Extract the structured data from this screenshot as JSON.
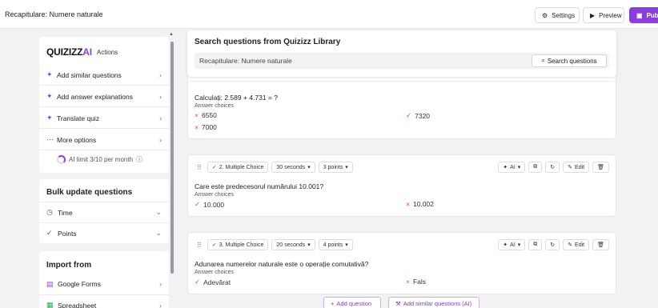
{
  "header": {
    "title": "Recapitulare: Numere naturale",
    "settings_label": "Settings",
    "preview_label": "Preview",
    "publish_label": "Publi"
  },
  "actions": {
    "logo_text": "QUIZIZZ",
    "logo_ai": "AI",
    "section_label": "Actions",
    "items": [
      {
        "label": "Add similar questions"
      },
      {
        "label": "Add answer explanations"
      },
      {
        "label": "Translate quiz"
      },
      {
        "label": "More options"
      }
    ],
    "ai_limit": "AI limit 3/10 per month",
    "ai_limit_fraction": 0.3
  },
  "bulk": {
    "title": "Bulk update questions",
    "items": [
      {
        "label": "Time"
      },
      {
        "label": "Points"
      }
    ]
  },
  "import": {
    "title": "Import from",
    "items": [
      {
        "label": "Google Forms"
      },
      {
        "label": "Spreadsheet"
      }
    ]
  },
  "search": {
    "title": "Search questions from Quizizz Library",
    "value": "Recapitulare: Numere naturale",
    "button_label": "Search questions"
  },
  "questions": [
    {
      "text": "Calculați: 2.589 + 4.731 = ?",
      "answer_choices_label": "Answer choices",
      "choices": [
        {
          "text": "6550",
          "correct": false
        },
        {
          "text": "7320",
          "correct": true
        },
        {
          "text": "7000",
          "correct": false
        }
      ]
    },
    {
      "type_label": "2. Multiple Choice",
      "time_label": "30 seconds",
      "points_label": "3 points",
      "ai_label": "AI",
      "edit_label": "Edit",
      "text": "Care este predecesorul numărului 10.001?",
      "answer_choices_label": "Answer choices",
      "choices": [
        {
          "text": "10.000",
          "correct": true
        },
        {
          "text": "10.002",
          "correct": false
        }
      ]
    },
    {
      "type_label": "3. Multiple Choice",
      "time_label": "20 seconds",
      "points_label": "4 points",
      "ai_label": "AI",
      "edit_label": "Edit",
      "text": "Adunarea numerelor naturale este o operație comutativă?",
      "answer_choices_label": "Answer choices",
      "choices": [
        {
          "text": "Adevărat",
          "correct": true
        },
        {
          "text": "Fals",
          "correct": false
        }
      ]
    }
  ],
  "footer": {
    "add_question_label": "Add question",
    "add_similar_label": "Add similar questions (AI)"
  },
  "colors": {
    "accent": "#8b3fd9",
    "correct": "#2ea44f",
    "incorrect": "#e5484d"
  }
}
